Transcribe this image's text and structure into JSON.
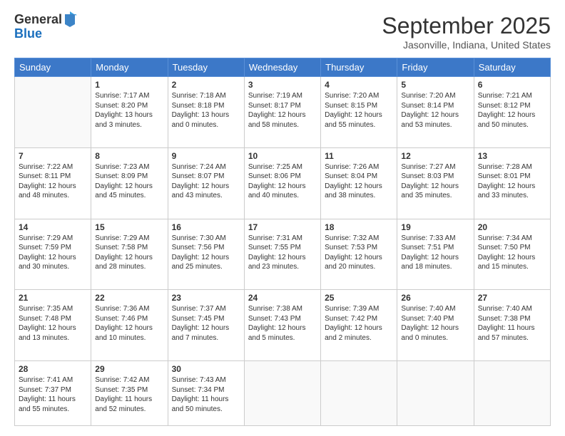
{
  "logo": {
    "general": "General",
    "blue": "Blue"
  },
  "title": {
    "month": "September 2025",
    "location": "Jasonville, Indiana, United States"
  },
  "weekdays": [
    "Sunday",
    "Monday",
    "Tuesday",
    "Wednesday",
    "Thursday",
    "Friday",
    "Saturday"
  ],
  "weeks": [
    [
      {
        "day": "",
        "content": ""
      },
      {
        "day": "1",
        "content": "Sunrise: 7:17 AM\nSunset: 8:20 PM\nDaylight: 13 hours\nand 3 minutes."
      },
      {
        "day": "2",
        "content": "Sunrise: 7:18 AM\nSunset: 8:18 PM\nDaylight: 13 hours\nand 0 minutes."
      },
      {
        "day": "3",
        "content": "Sunrise: 7:19 AM\nSunset: 8:17 PM\nDaylight: 12 hours\nand 58 minutes."
      },
      {
        "day": "4",
        "content": "Sunrise: 7:20 AM\nSunset: 8:15 PM\nDaylight: 12 hours\nand 55 minutes."
      },
      {
        "day": "5",
        "content": "Sunrise: 7:20 AM\nSunset: 8:14 PM\nDaylight: 12 hours\nand 53 minutes."
      },
      {
        "day": "6",
        "content": "Sunrise: 7:21 AM\nSunset: 8:12 PM\nDaylight: 12 hours\nand 50 minutes."
      }
    ],
    [
      {
        "day": "7",
        "content": "Sunrise: 7:22 AM\nSunset: 8:11 PM\nDaylight: 12 hours\nand 48 minutes."
      },
      {
        "day": "8",
        "content": "Sunrise: 7:23 AM\nSunset: 8:09 PM\nDaylight: 12 hours\nand 45 minutes."
      },
      {
        "day": "9",
        "content": "Sunrise: 7:24 AM\nSunset: 8:07 PM\nDaylight: 12 hours\nand 43 minutes."
      },
      {
        "day": "10",
        "content": "Sunrise: 7:25 AM\nSunset: 8:06 PM\nDaylight: 12 hours\nand 40 minutes."
      },
      {
        "day": "11",
        "content": "Sunrise: 7:26 AM\nSunset: 8:04 PM\nDaylight: 12 hours\nand 38 minutes."
      },
      {
        "day": "12",
        "content": "Sunrise: 7:27 AM\nSunset: 8:03 PM\nDaylight: 12 hours\nand 35 minutes."
      },
      {
        "day": "13",
        "content": "Sunrise: 7:28 AM\nSunset: 8:01 PM\nDaylight: 12 hours\nand 33 minutes."
      }
    ],
    [
      {
        "day": "14",
        "content": "Sunrise: 7:29 AM\nSunset: 7:59 PM\nDaylight: 12 hours\nand 30 minutes."
      },
      {
        "day": "15",
        "content": "Sunrise: 7:29 AM\nSunset: 7:58 PM\nDaylight: 12 hours\nand 28 minutes."
      },
      {
        "day": "16",
        "content": "Sunrise: 7:30 AM\nSunset: 7:56 PM\nDaylight: 12 hours\nand 25 minutes."
      },
      {
        "day": "17",
        "content": "Sunrise: 7:31 AM\nSunset: 7:55 PM\nDaylight: 12 hours\nand 23 minutes."
      },
      {
        "day": "18",
        "content": "Sunrise: 7:32 AM\nSunset: 7:53 PM\nDaylight: 12 hours\nand 20 minutes."
      },
      {
        "day": "19",
        "content": "Sunrise: 7:33 AM\nSunset: 7:51 PM\nDaylight: 12 hours\nand 18 minutes."
      },
      {
        "day": "20",
        "content": "Sunrise: 7:34 AM\nSunset: 7:50 PM\nDaylight: 12 hours\nand 15 minutes."
      }
    ],
    [
      {
        "day": "21",
        "content": "Sunrise: 7:35 AM\nSunset: 7:48 PM\nDaylight: 12 hours\nand 13 minutes."
      },
      {
        "day": "22",
        "content": "Sunrise: 7:36 AM\nSunset: 7:46 PM\nDaylight: 12 hours\nand 10 minutes."
      },
      {
        "day": "23",
        "content": "Sunrise: 7:37 AM\nSunset: 7:45 PM\nDaylight: 12 hours\nand 7 minutes."
      },
      {
        "day": "24",
        "content": "Sunrise: 7:38 AM\nSunset: 7:43 PM\nDaylight: 12 hours\nand 5 minutes."
      },
      {
        "day": "25",
        "content": "Sunrise: 7:39 AM\nSunset: 7:42 PM\nDaylight: 12 hours\nand 2 minutes."
      },
      {
        "day": "26",
        "content": "Sunrise: 7:40 AM\nSunset: 7:40 PM\nDaylight: 12 hours\nand 0 minutes."
      },
      {
        "day": "27",
        "content": "Sunrise: 7:40 AM\nSunset: 7:38 PM\nDaylight: 11 hours\nand 57 minutes."
      }
    ],
    [
      {
        "day": "28",
        "content": "Sunrise: 7:41 AM\nSunset: 7:37 PM\nDaylight: 11 hours\nand 55 minutes."
      },
      {
        "day": "29",
        "content": "Sunrise: 7:42 AM\nSunset: 7:35 PM\nDaylight: 11 hours\nand 52 minutes."
      },
      {
        "day": "30",
        "content": "Sunrise: 7:43 AM\nSunset: 7:34 PM\nDaylight: 11 hours\nand 50 minutes."
      },
      {
        "day": "",
        "content": ""
      },
      {
        "day": "",
        "content": ""
      },
      {
        "day": "",
        "content": ""
      },
      {
        "day": "",
        "content": ""
      }
    ]
  ]
}
